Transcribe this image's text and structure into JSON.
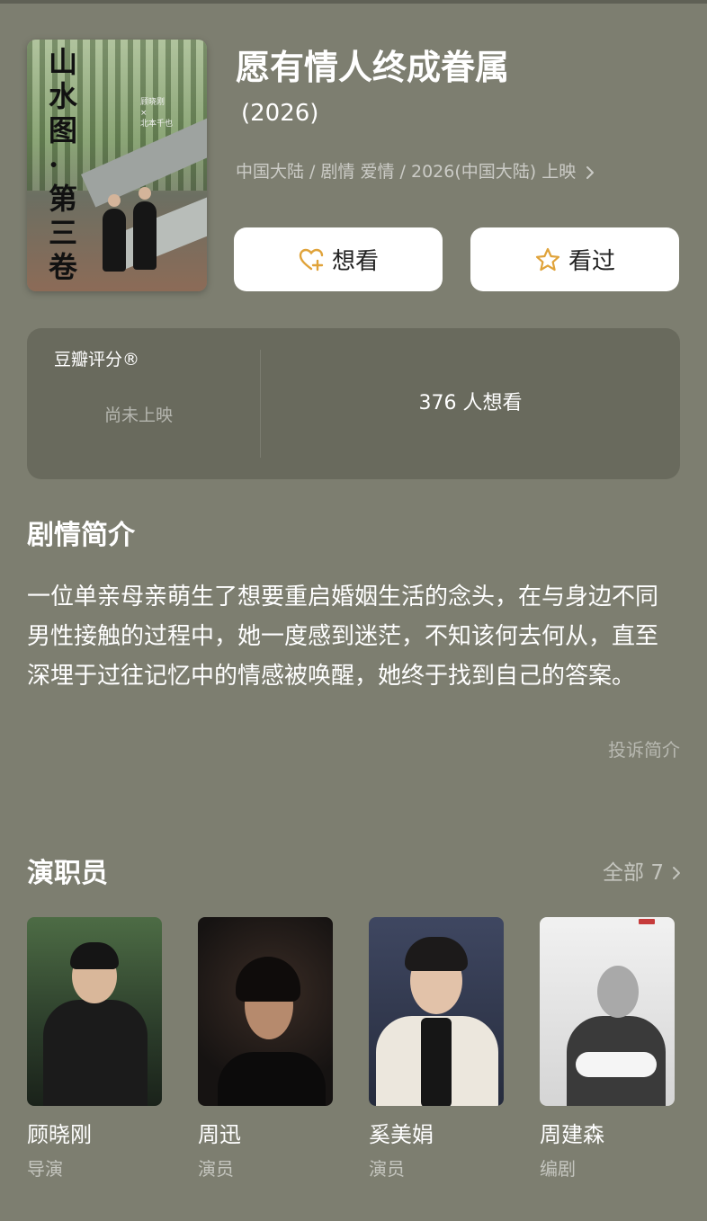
{
  "movie": {
    "title": "愿有情人终成眷属",
    "year": "(2026)",
    "meta": "中国大陆 / 剧情 爱情 / 2026(中国大陆) 上映",
    "poster": {
      "title_vertical": "山水图·第三卷",
      "credits": [
        "顾晓刚",
        "×",
        "北本千也"
      ]
    }
  },
  "actions": {
    "want": "想看",
    "seen": "看过"
  },
  "rating": {
    "title": "豆瓣评分®",
    "status": "尚未上映",
    "want_count": "376 人想看"
  },
  "synopsis": {
    "title": "剧情简介",
    "text": "一位单亲母亲萌生了想要重启婚姻生活的念头，在与身边不同男性接触的过程中，她一度感到迷茫，不知该何去何从，直至深埋于过往记忆中的情感被唤醒，她终于找到自己的答案。",
    "report": "投诉简介"
  },
  "cast": {
    "title": "演职员",
    "all_label": "全部 7",
    "members": [
      {
        "name": "顾晓刚",
        "role": "导演"
      },
      {
        "name": "周迅",
        "role": "演员"
      },
      {
        "name": "奚美娟",
        "role": "演员"
      },
      {
        "name": "周建森",
        "role": "编剧"
      }
    ]
  },
  "colors": {
    "background": "#7d7e70",
    "card": "#696a5d",
    "heart_accent": "#e0a33a",
    "star_accent": "#e0a33a"
  }
}
